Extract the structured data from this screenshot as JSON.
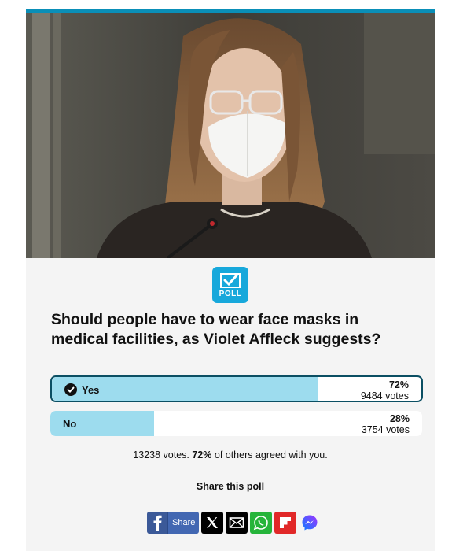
{
  "poll": {
    "badge_label": "POLL",
    "question": "Should people have to wear face masks in medical facilities, as Violet Affleck suggests?",
    "options": [
      {
        "label": "Yes",
        "percent": "72%",
        "votes": "9484 votes",
        "fill_fraction": 0.72,
        "selected": true
      },
      {
        "label": "No",
        "percent": "28%",
        "votes": "3754 votes",
        "fill_fraction": 0.28,
        "selected": false
      }
    ],
    "summary_prefix": "13238 votes. ",
    "summary_percent": "72%",
    "summary_suffix": " of others agreed with you."
  },
  "share": {
    "title": "Share this poll",
    "facebook_label": "Share",
    "buttons": [
      "facebook-icon",
      "x-icon",
      "email-icon",
      "whatsapp-icon",
      "flipboard-icon",
      "messenger-icon"
    ]
  },
  "colors": {
    "accent": "#17a8db",
    "bar_fill": "#9ddcee",
    "selected_border": "#0b4f63"
  }
}
